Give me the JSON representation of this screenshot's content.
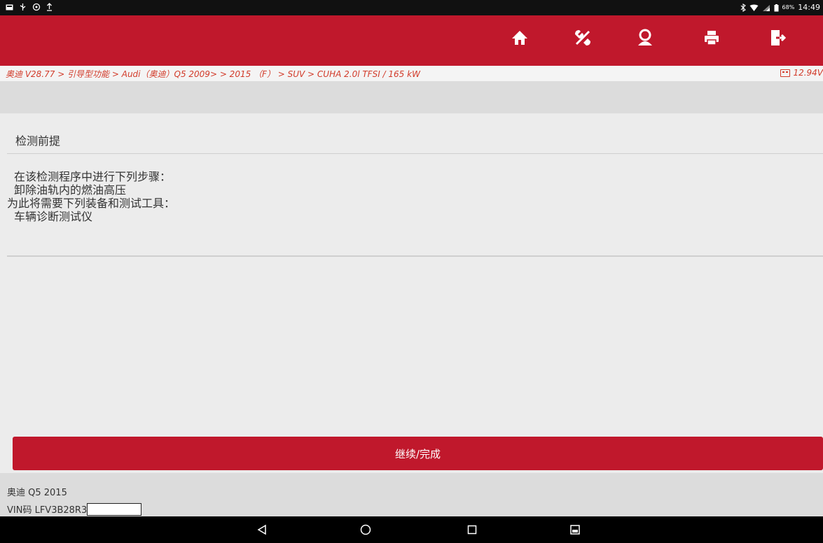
{
  "status_bar": {
    "left_icons": [
      "notification-icon",
      "usb-icon",
      "settings-notif-icon",
      "upload-icon"
    ],
    "battery_text": "68%",
    "time": "14:49"
  },
  "toolbar": {
    "buttons": [
      {
        "name": "home-icon"
      },
      {
        "name": "diagnose-tools-icon"
      },
      {
        "name": "user-icon"
      },
      {
        "name": "print-icon"
      },
      {
        "name": "exit-icon"
      }
    ]
  },
  "breadcrumb": {
    "text": "奥迪 V28.77 > 引导型功能 > Audi（奥迪）Q5 2009> > 2015 （F） > SUV > CUHA 2.0l TFSI / 165 kW",
    "voltage": "12.94V"
  },
  "main": {
    "section_title": "检测前提",
    "lines": [
      "在该检测程序中进行下列步骤：",
      "卸除油轨内的燃油高压",
      "为此将需要下列装备和测试工具：",
      "车辆诊断测试仪"
    ]
  },
  "continue_button": "继续/完成",
  "footer": {
    "vehicle": "奥迪 Q5 2015",
    "vin_label": "VIN码 LFV3B28R3"
  },
  "colors": {
    "accent": "#c0182c",
    "breadcrumb": "#d23b2a",
    "background": "#ececec"
  }
}
